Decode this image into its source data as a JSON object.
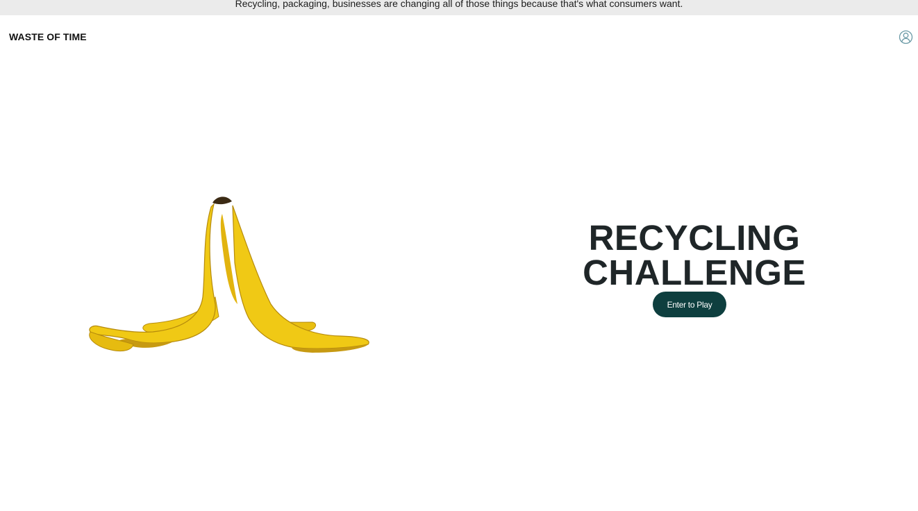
{
  "announcement": {
    "text": "Recycling, packaging, businesses are changing all of those things because that's what consumers want."
  },
  "header": {
    "brand": "WASTE OF TIME",
    "account_icon": "user-circle-icon"
  },
  "hero": {
    "title_line_1": "RECYCLING",
    "title_line_2": "CHALLENGE",
    "cta_label": "Enter to Play",
    "illustration": "banana-peel"
  },
  "colors": {
    "announcement_bg": "#ebebeb",
    "title": "#1f2628",
    "cta_bg": "#0e3f3f",
    "cta_text": "#ffffff",
    "account_icon": "#6a9aa6",
    "banana_yellow": "#f0c915",
    "banana_shade": "#c79a12",
    "banana_stem": "#3b2a14"
  }
}
